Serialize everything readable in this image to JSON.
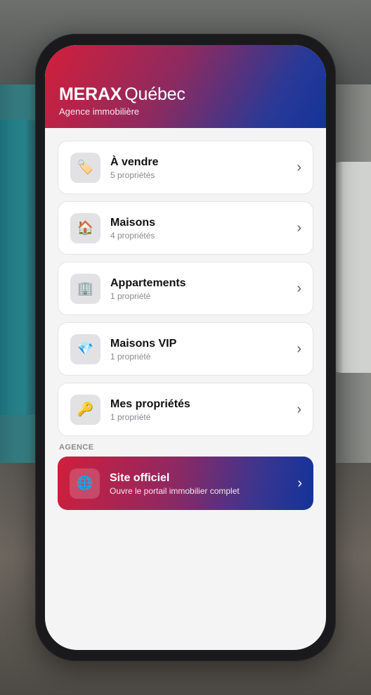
{
  "app": {
    "brand_strong": "MERAX",
    "brand_light": "Québec",
    "tagline": "Agence immobilière"
  },
  "menu": [
    {
      "title": "À vendre",
      "subtitle": "5 propriétés",
      "icon": "🏷️",
      "icon_name": "tag-icon"
    },
    {
      "title": "Maisons",
      "subtitle": "4 propriétés",
      "icon": "🏠",
      "icon_name": "house-icon"
    },
    {
      "title": "Appartements",
      "subtitle": "1 propriété",
      "icon": "🏢",
      "icon_name": "building-icon"
    },
    {
      "title": "Maisons VIP",
      "subtitle": "1 propriété",
      "icon": "💎",
      "icon_name": "diamond-icon"
    },
    {
      "title": "Mes propriétés",
      "subtitle": "1 propriété",
      "icon": "🔑",
      "icon_name": "key-icon"
    }
  ],
  "agence": {
    "section_label": "AGENCE",
    "title": "Site officiel",
    "subtitle": "Ouvre le portail immobilier complet",
    "icon": "🌐",
    "icon_name": "globe-icon"
  },
  "chevron": "›",
  "colors": {
    "gradient_start": "#d31f3a",
    "gradient_end": "#13349a",
    "screen_bg": "#f4f4f5"
  }
}
